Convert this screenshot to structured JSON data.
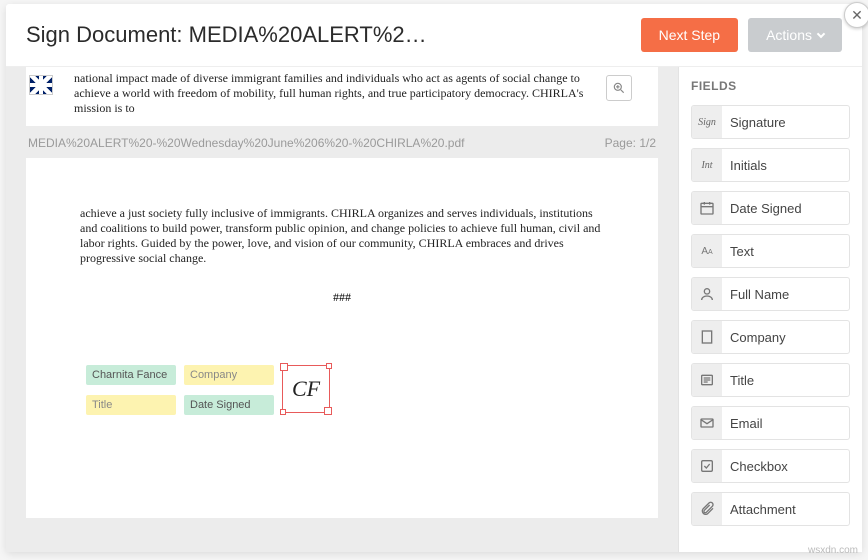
{
  "header": {
    "title": "Sign Document: MEDIA%20ALERT%2…",
    "next": "Next Step",
    "actions": "Actions"
  },
  "doc": {
    "top_text": "national impact made of diverse immigrant families and individuals who act as agents of social change to achieve a world with freedom of mobility, full human rights, and true participatory democracy. CHIRLA's mission is to",
    "filename": "MEDIA%20ALERT%20-%20Wednesday%20June%206%20-%20CHIRLA%20.pdf",
    "page_label": "Page: 1/2",
    "body_text": "achieve a just society fully inclusive of immigrants. CHIRLA organizes and serves individuals, institutions and coalitions to build power, transform public opinion, and change policies to achieve full human, civil and labor rights. Guided by the power, love, and vision of our community, CHIRLA embraces and drives progressive social change.",
    "sep": "###",
    "tags": {
      "name": "Charnita Fance",
      "company": "Company",
      "title": "Title",
      "date": "Date Signed",
      "sig_glyph": "CF"
    }
  },
  "fields": {
    "title": "FIELDS",
    "items": [
      {
        "label": "Signature",
        "icon": "sign"
      },
      {
        "label": "Initials",
        "icon": "int"
      },
      {
        "label": "Date Signed",
        "icon": "cal"
      },
      {
        "label": "Text",
        "icon": "text"
      },
      {
        "label": "Full Name",
        "icon": "person"
      },
      {
        "label": "Company",
        "icon": "building"
      },
      {
        "label": "Title",
        "icon": "list"
      },
      {
        "label": "Email",
        "icon": "mail"
      },
      {
        "label": "Checkbox",
        "icon": "check"
      },
      {
        "label": "Attachment",
        "icon": "clip"
      }
    ]
  },
  "watermark": "wsxdn.com"
}
